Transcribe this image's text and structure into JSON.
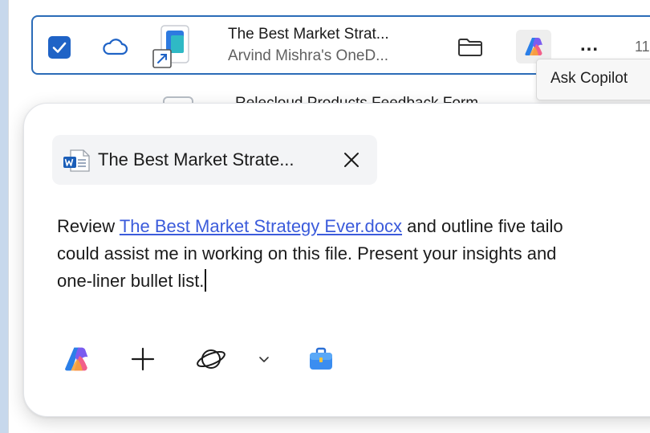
{
  "file_row": {
    "name": "The Best Market Strat...",
    "location": "Arvind Mishra's OneD...",
    "more_label": "...",
    "trailing_text": "11"
  },
  "tooltip": {
    "text": "Ask Copilot"
  },
  "next_row": {
    "name": "Relecloud Products Feedback Form"
  },
  "composer": {
    "chip_label": "The Best Market Strate...",
    "prompt_line1_before": "Review ",
    "prompt_link": "The Best Market Strategy Ever.docx",
    "prompt_line1_after": " and outline five tailo",
    "prompt_line2": "could assist me in working on this file. Present your insights and",
    "prompt_line3": "one-liner bullet list."
  },
  "toolbar": {
    "icons": [
      "copilot-icon",
      "plus-icon",
      "web-grounding-icon",
      "chevron-down-icon",
      "briefcase-icon"
    ]
  },
  "colors": {
    "accent": "#1f63c6",
    "selection_border": "#2b6cb8",
    "link": "#3b5bdb",
    "background": "#c7d8ec"
  }
}
